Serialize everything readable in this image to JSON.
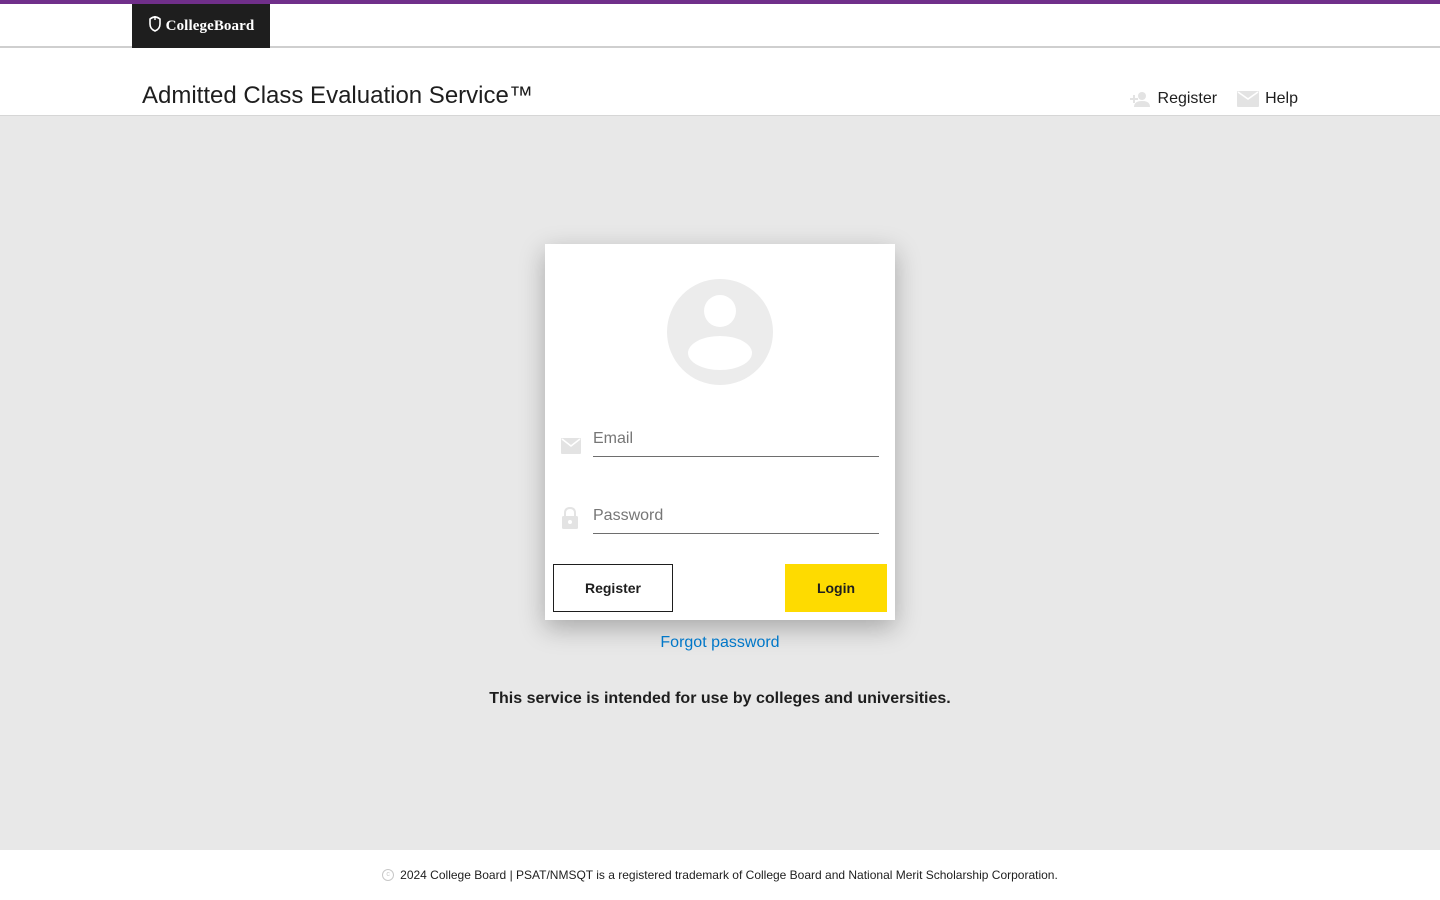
{
  "brand": {
    "name": "CollegeBoard"
  },
  "header": {
    "title": "Admitted Class Evaluation Service™",
    "nav": {
      "register_label": "Register",
      "help_label": "Help"
    }
  },
  "login": {
    "email_placeholder": "Email",
    "email_value": "",
    "password_placeholder": "Password",
    "password_value": "",
    "register_button": "Register",
    "login_button": "Login",
    "forgot_link": "Forgot password"
  },
  "notice": "This service is intended for use by colleges and universities.",
  "footer": {
    "text": "2024 College Board | PSAT/NMSQT is a registered trademark of College Board and National Merit Scholarship Corporation."
  },
  "icons": {
    "logo": "acorn-shield-icon",
    "register": "add-person-icon",
    "help": "mail-icon",
    "avatar": "account-circle-icon",
    "email_field": "mail-icon",
    "password_field": "lock-icon",
    "footer": "copyright-icon"
  },
  "colors": {
    "accent_bar": "#702f8a",
    "login_button": "#fedb00",
    "link": "#0077c8",
    "logo_bg": "#1e1e1e",
    "page_bg": "#e8e8e8"
  }
}
